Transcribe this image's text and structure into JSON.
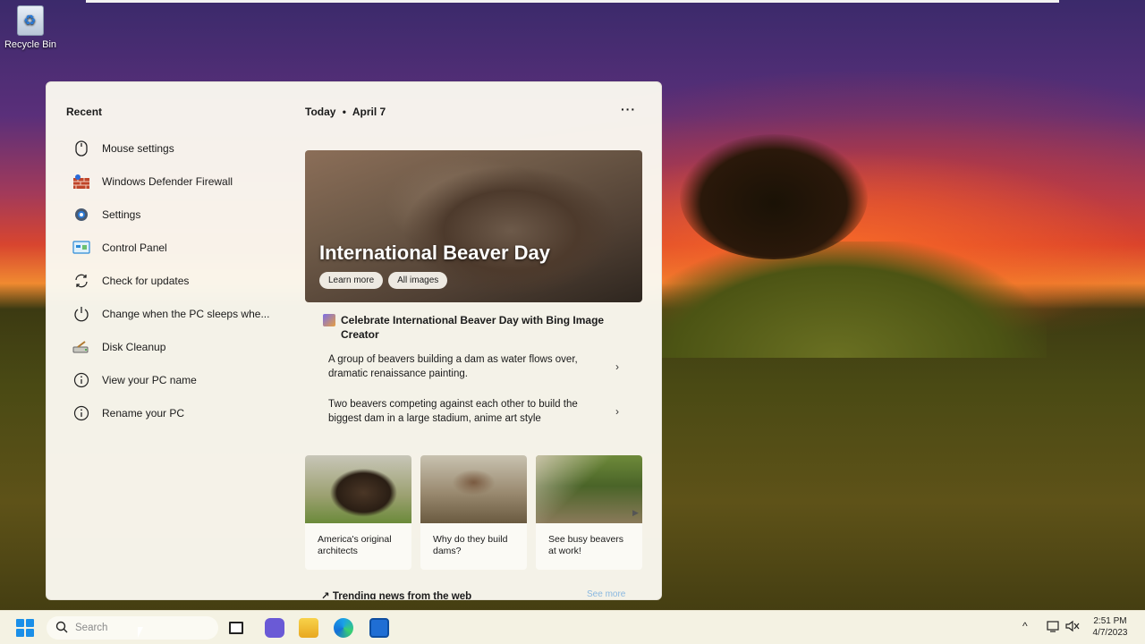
{
  "desktop": {
    "recycle_bin_label": "Recycle Bin"
  },
  "widgets": {
    "recent": {
      "title": "Recent",
      "items": [
        {
          "label": "Mouse settings",
          "icon": "mouse-icon"
        },
        {
          "label": "Windows Defender Firewall",
          "icon": "firewall-icon"
        },
        {
          "label": "Settings",
          "icon": "gear-icon"
        },
        {
          "label": "Control Panel",
          "icon": "control-panel-icon"
        },
        {
          "label": "Check for updates",
          "icon": "refresh-icon"
        },
        {
          "label": "Change when the PC sleeps whe...",
          "icon": "power-icon"
        },
        {
          "label": "Disk Cleanup",
          "icon": "disk-cleanup-icon"
        },
        {
          "label": "View your PC name",
          "icon": "info-icon"
        },
        {
          "label": "Rename your PC",
          "icon": "info-icon"
        }
      ]
    },
    "today": {
      "label": "Today",
      "separator": "•",
      "date": "April 7",
      "more_label": "···"
    },
    "hero": {
      "title": "International Beaver Day",
      "learn_more_label": "Learn more",
      "all_images_label": "All images"
    },
    "bing_card": {
      "title": "Celebrate International Beaver Day with Bing Image Creator",
      "prompts": [
        "A group of beavers building a dam as water flows over, dramatic renaissance painting.",
        "Two beavers competing against each other to build the biggest dam in a large stadium, anime art style"
      ],
      "chevron": "›"
    },
    "thumbnails": [
      {
        "caption": "America's original architects"
      },
      {
        "caption": "Why do they build dams?"
      },
      {
        "caption": "See busy beavers at work!"
      }
    ],
    "trending": {
      "title": "Trending news from the web",
      "see_more_label": "See more"
    }
  },
  "taskbar": {
    "search_placeholder": "Search",
    "time": "2:51 PM",
    "date": "4/7/2023"
  }
}
